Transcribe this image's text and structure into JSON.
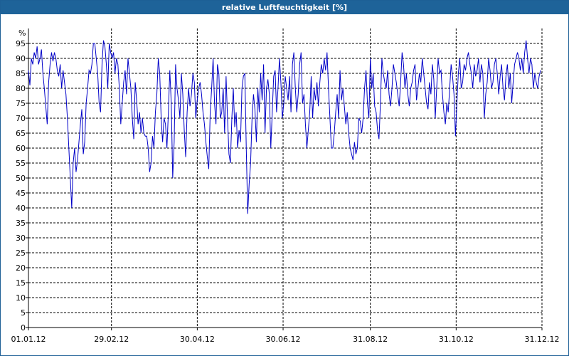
{
  "window": {
    "title": "relative Luftfeuchtigkeit [%]"
  },
  "chart_data": {
    "type": "line",
    "title": "relative Luftfeuchtigkeit [%]",
    "y_unit": "%",
    "ylim": [
      0,
      100
    ],
    "yticks": [
      0,
      5,
      10,
      15,
      20,
      25,
      30,
      35,
      40,
      45,
      50,
      55,
      60,
      65,
      70,
      75,
      80,
      85,
      90,
      95
    ],
    "xlim": [
      "2012-01-01",
      "2012-12-31"
    ],
    "xticks": [
      {
        "date": "2012-01-01",
        "label": "01.01.12"
      },
      {
        "date": "2012-02-29",
        "label": "29.02.12"
      },
      {
        "date": "2012-04-30",
        "label": "30.04.12"
      },
      {
        "date": "2012-06-30",
        "label": "30.06.12"
      },
      {
        "date": "2012-08-31",
        "label": "31.08.12"
      },
      {
        "date": "2012-10-31",
        "label": "31.10.12"
      },
      {
        "date": "2012-12-31",
        "label": "31.12.12"
      }
    ],
    "grid": true,
    "line_color": "#0000c8",
    "series": [
      {
        "values": [
          86,
          81,
          90,
          88,
          92,
          90,
          94,
          88,
          90,
          93,
          85,
          80,
          74,
          68,
          82,
          88,
          92,
          89,
          92,
          90,
          86,
          84,
          88,
          80,
          86,
          82,
          78,
          70,
          60,
          50,
          40,
          55,
          60,
          52,
          56,
          62,
          68,
          73,
          58,
          62,
          75,
          80,
          86,
          85,
          88,
          95,
          95,
          90,
          85,
          75,
          72,
          88,
          96,
          94,
          88,
          80,
          95,
          92,
          90,
          92,
          85,
          90,
          88,
          80,
          68,
          75,
          82,
          86,
          78,
          90,
          85,
          80,
          70,
          63,
          82,
          76,
          68,
          72,
          65,
          70,
          65,
          64,
          64,
          60,
          52,
          55,
          64,
          60,
          72,
          78,
          90,
          85,
          70,
          62,
          70,
          68,
          60,
          72,
          86,
          75,
          50,
          62,
          88,
          80,
          76,
          70,
          85,
          78,
          66,
          57,
          72,
          80,
          74,
          78,
          85,
          82,
          70,
          76,
          80,
          82,
          78,
          72,
          68,
          62,
          57,
          53,
          72,
          80,
          90,
          75,
          68,
          88,
          85,
          70,
          72,
          80,
          65,
          84,
          70,
          58,
          55,
          70,
          80,
          67,
          72,
          60,
          66,
          62,
          80,
          84,
          85,
          60,
          38,
          48,
          55,
          70,
          78,
          73,
          62,
          80,
          72,
          85,
          76,
          88,
          65,
          80,
          83,
          78,
          60,
          72,
          84,
          86,
          72,
          80,
          90,
          82,
          70,
          75,
          84,
          80,
          76,
          84,
          72,
          88,
          92,
          80,
          72,
          78,
          88,
          92,
          75,
          78,
          68,
          60,
          66,
          72,
          84,
          70,
          80,
          76,
          82,
          74,
          82,
          88,
          85,
          90,
          86,
          92,
          80,
          70,
          60,
          60,
          65,
          72,
          78,
          70,
          86,
          76,
          80,
          74,
          68,
          72,
          65,
          60,
          58,
          56,
          62,
          58,
          60,
          70,
          69,
          65,
          70,
          80,
          86,
          75,
          70,
          90,
          80,
          85,
          74,
          72,
          66,
          63,
          75,
          90,
          85,
          82,
          80,
          86,
          78,
          74,
          80,
          88,
          85,
          82,
          78,
          74,
          82,
          92,
          88,
          80,
          85,
          78,
          74,
          80,
          82,
          86,
          88,
          76,
          80,
          85,
          82,
          90,
          85,
          80,
          75,
          73,
          82,
          78,
          88,
          83,
          70,
          80,
          90,
          85,
          86,
          78,
          72,
          68,
          75,
          72,
          80,
          88,
          84,
          78,
          64,
          75,
          85,
          90,
          80,
          82,
          88,
          86,
          90,
          92,
          88,
          85,
          80,
          88,
          84,
          86,
          90,
          82,
          88,
          85,
          70,
          78,
          82,
          90,
          86,
          80,
          82,
          88,
          90,
          85,
          78,
          84,
          88,
          80,
          76,
          84,
          88,
          80,
          85,
          75,
          82,
          88,
          90,
          92,
          90,
          86,
          90,
          85,
          92,
          96,
          90,
          85,
          90,
          88,
          80,
          85,
          82,
          80,
          84,
          86
        ]
      }
    ]
  }
}
